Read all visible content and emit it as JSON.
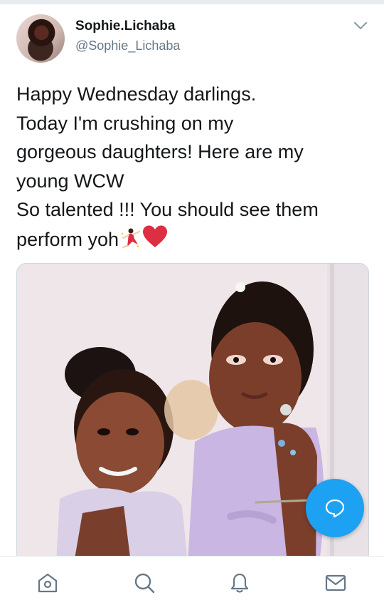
{
  "tweet": {
    "display_name": "Sophie.Lichaba",
    "handle": "@Sophie_Lichaba",
    "text_lines": [
      "Happy Wednesday darlings.",
      "Today I'm crushing on my",
      "gorgeous daughters! Here are my",
      "young WCW",
      "So talented !!! You should see them",
      "perform yoh"
    ],
    "emojis": [
      "dancer-emoji",
      "heart-emoji"
    ]
  },
  "icons": {
    "menu": "chevron-down-icon",
    "compose_reply": "speech-bubble-icon",
    "tabs": [
      "home-icon",
      "search-icon",
      "notifications-bell-icon",
      "messages-envelope-icon"
    ]
  },
  "colors": {
    "accent": "#1da1f2",
    "text": "#14171a",
    "secondary_text": "#657786",
    "divider": "#e6ecf0"
  }
}
